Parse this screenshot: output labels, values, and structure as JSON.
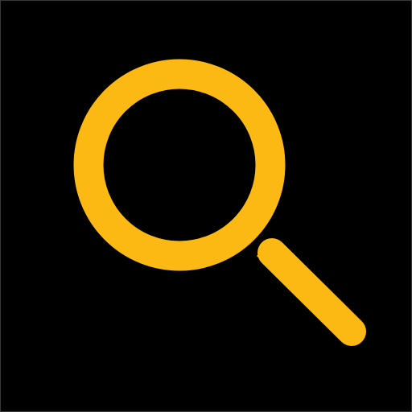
{
  "icon": {
    "name": "search-icon",
    "accent_color": "#FDB913",
    "background_color": "#000000"
  }
}
